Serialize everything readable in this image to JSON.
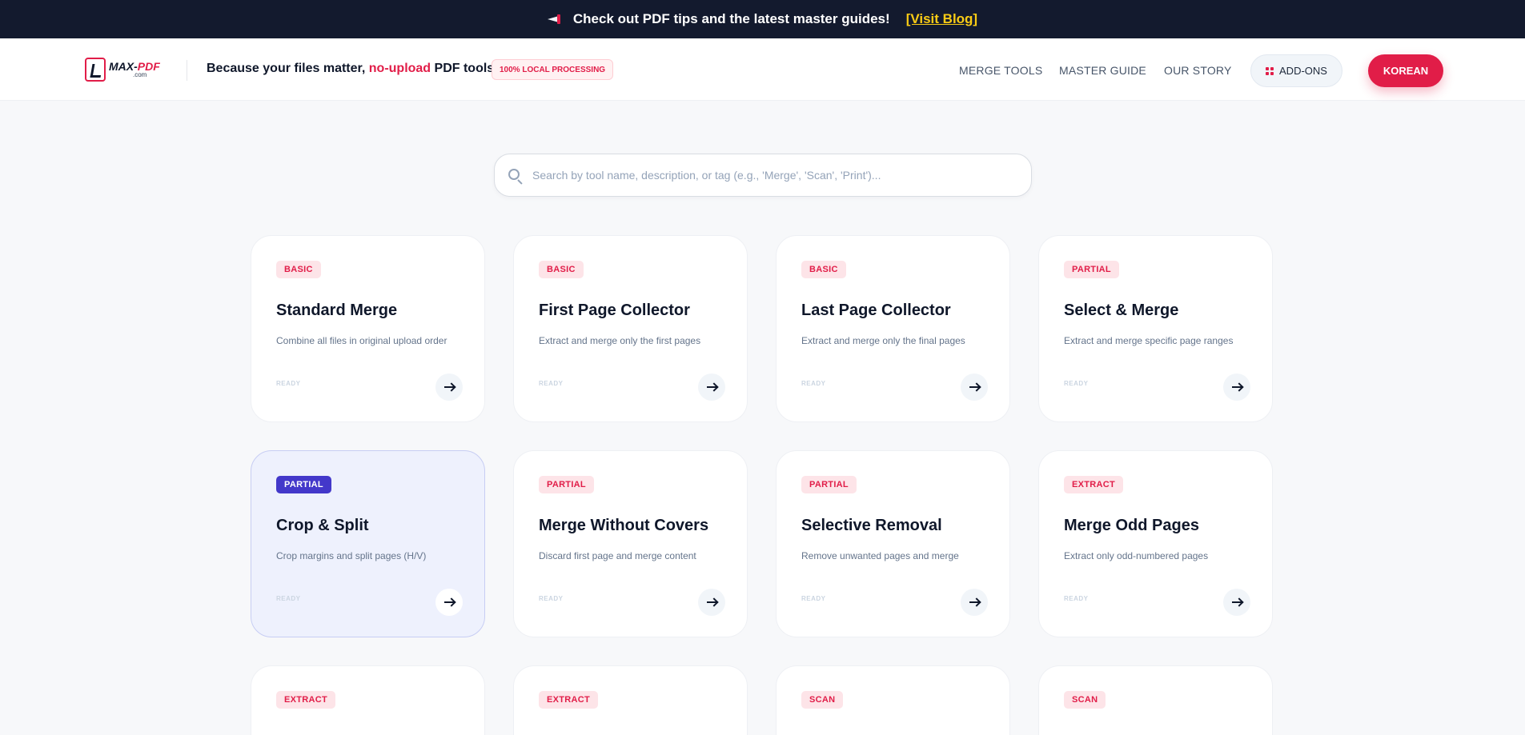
{
  "announcement": {
    "text": "Check out PDF tips and the latest master guides!",
    "link": "[Visit Blog]"
  },
  "header": {
    "logo_main": "MAX-",
    "logo_accent": "PDF",
    "logo_sub": ".com",
    "tagline_start": "Because your files matter, ",
    "tagline_highlight": "no-upload",
    "tagline_end": " PDF tools",
    "badge": "100% LOCAL PROCESSING",
    "nav": [
      "MERGE TOOLS",
      "MASTER GUIDE",
      "OUR STORY"
    ],
    "addons_label": "ADD-ONS",
    "language_label": "KOREAN"
  },
  "search": {
    "placeholder": "Search by tool name, description, or tag (e.g., 'Merge', 'Scan', 'Print')...",
    "value": ""
  },
  "cards": [
    {
      "badge": "BASIC",
      "title": "Standard Merge",
      "desc": "Combine all files in original upload order",
      "status": "READY"
    },
    {
      "badge": "BASIC",
      "title": "First Page Collector",
      "desc": "Extract and merge only the first pages",
      "status": "READY"
    },
    {
      "badge": "BASIC",
      "title": "Last Page Collector",
      "desc": "Extract and merge only the final pages",
      "status": "READY"
    },
    {
      "badge": "PARTIAL",
      "title": "Select & Merge",
      "desc": "Extract and merge specific page ranges",
      "status": "READY"
    },
    {
      "badge": "PARTIAL",
      "title": "Crop & Split",
      "desc": "Crop margins and split pages (H/V)",
      "status": "READY"
    },
    {
      "badge": "PARTIAL",
      "title": "Merge Without Covers",
      "desc": "Discard first page and merge content",
      "status": "READY"
    },
    {
      "badge": "PARTIAL",
      "title": "Selective Removal",
      "desc": "Remove unwanted pages and merge",
      "status": "READY"
    },
    {
      "badge": "EXTRACT",
      "title": "Merge Odd Pages",
      "desc": "Extract only odd-numbered pages",
      "status": "READY"
    },
    {
      "badge": "EXTRACT"
    },
    {
      "badge": "EXTRACT"
    },
    {
      "badge": "SCAN"
    },
    {
      "badge": "SCAN"
    }
  ],
  "colors": {
    "accent": "#e11d48",
    "dark_bar": "#131a2e",
    "active_badge": "#4338ca",
    "active_card_bg": "#eef1fd"
  }
}
